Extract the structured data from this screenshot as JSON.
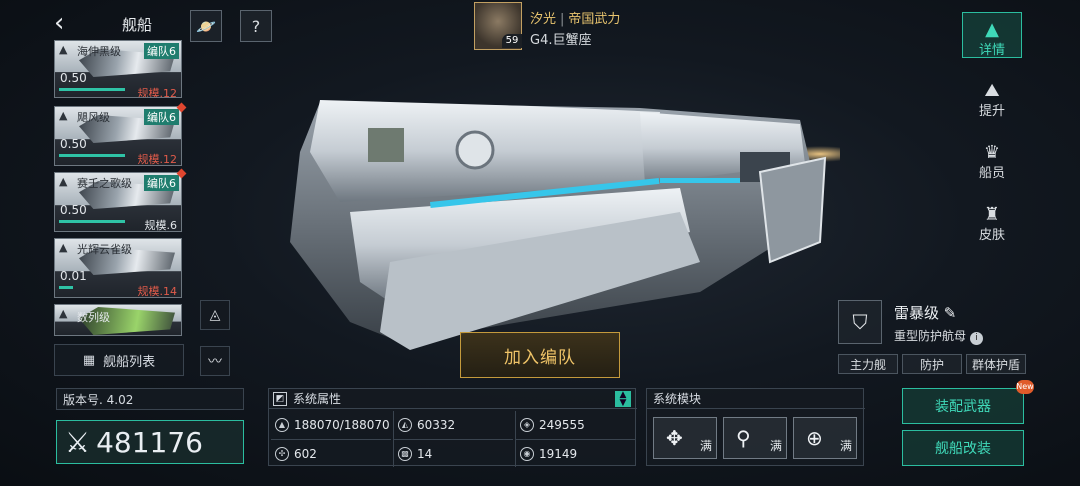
{
  "topbar": {
    "title": "舰船",
    "back_icon": "‹",
    "btn1_icon": "🪐",
    "btn2_icon": "?"
  },
  "player": {
    "level": "59",
    "name": "汐光",
    "faction": "帝国武力",
    "zone": "G4.巨蟹座"
  },
  "ship_list": [
    {
      "name": "海伸黑级",
      "badge": "编队6",
      "value": "0.50",
      "scale": "规模.12",
      "scale_color": "red"
    },
    {
      "name": "飓风级",
      "badge": "编队6",
      "value": "0.50",
      "scale": "规模.12",
      "scale_color": "red",
      "alert": true
    },
    {
      "name": "赛壬之歌级",
      "badge": "编队6",
      "value": "0.50",
      "scale": "规模.6",
      "scale_color": "white",
      "alert": true
    },
    {
      "name": "光辉云雀级",
      "badge": "",
      "value": "0.01",
      "scale": "规模.14",
      "scale_color": "red"
    },
    {
      "name": "数列级",
      "badge": "",
      "value": "",
      "scale": ""
    }
  ],
  "list_button": "舰船列表",
  "version": "版本号. 4.02",
  "power": "481176",
  "join_button": "加入编队",
  "system_attrs": {
    "title": "系统属性",
    "cells": [
      {
        "icon": "ship-hp-icon",
        "value": "188070/188070"
      },
      {
        "icon": "armor-icon",
        "value": "60332"
      },
      {
        "icon": "shield-icon",
        "value": "249555"
      },
      {
        "icon": "speed-icon",
        "value": "602"
      },
      {
        "icon": "checker-icon",
        "value": "14"
      },
      {
        "icon": "target-icon",
        "value": "19149"
      }
    ]
  },
  "system_modules": {
    "title": "系统模块",
    "items": [
      {
        "icon": "dpad-icon",
        "label": "满"
      },
      {
        "icon": "antenna-icon",
        "label": "满"
      },
      {
        "icon": "medkit-icon",
        "label": "满"
      }
    ]
  },
  "right_nav": [
    {
      "label": "详情",
      "active": true
    },
    {
      "label": "提升",
      "active": false
    },
    {
      "label": "船员",
      "active": false
    },
    {
      "label": "皮肤",
      "active": false
    }
  ],
  "ship_info": {
    "name": "雷暴级",
    "type": "重型防护航母",
    "tags": [
      "主力舰",
      "防护",
      "群体护盾"
    ]
  },
  "actions": {
    "equip": "装配武器",
    "modify": "舰船改装",
    "new_badge": "New"
  }
}
